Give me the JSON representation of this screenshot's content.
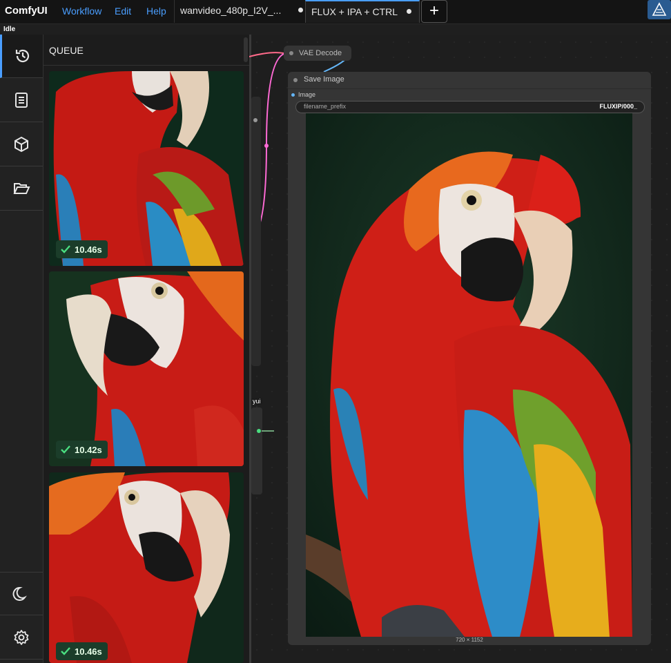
{
  "menubar": {
    "brand": "ComfyUI",
    "menu": [
      "Workflow",
      "Edit",
      "Help"
    ],
    "tabs": [
      {
        "label": "wanvideo_480p_I2V_..."
      },
      {
        "label": "FLUX + IPA + CTRL"
      }
    ],
    "add_tab": "+"
  },
  "status": "Idle",
  "sidebar": {
    "items": [
      {
        "icon": "history-icon"
      },
      {
        "icon": "document-icon"
      },
      {
        "icon": "cube-icon"
      },
      {
        "icon": "folder-open-icon"
      }
    ],
    "bottom": [
      {
        "icon": "moon-icon"
      },
      {
        "icon": "gear-icon"
      }
    ]
  },
  "queue": {
    "title": "QUEUE",
    "items": [
      {
        "time": "10.46s"
      },
      {
        "time": "10.42s"
      },
      {
        "time": "10.46s"
      }
    ]
  },
  "canvas": {
    "vae_node": {
      "title": "VAE Decode"
    },
    "save_node": {
      "title": "Save Image",
      "input_label": "Image",
      "prefix_key": "filename_prefix",
      "prefix_value": "FLUXIP/000_",
      "dimensions": "720 × 1152"
    },
    "partial_node_label": "yui"
  },
  "colors": {
    "accent": "#4a9eff",
    "success": "#4ade80",
    "wire_pink": "#ff6ad5",
    "wire_blue": "#64b5f6"
  }
}
